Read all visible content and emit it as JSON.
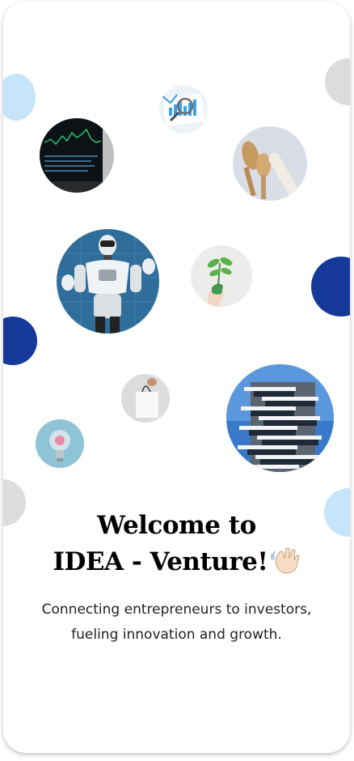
{
  "welcome": {
    "title_line1": "Welcome to",
    "title_line2": "IDEA - Venture!",
    "subtitle_line1": "Connecting entrepreneurs to investors,",
    "subtitle_line2": "fueling innovation and growth."
  },
  "colors": {
    "light_blue": "#c6e5fb",
    "dark_blue": "#17399a",
    "light_gray": "#dcdcdc",
    "background": "#ffffff"
  },
  "images": [
    "stock-chart-laptop",
    "analytics-report",
    "wooden-kitchen-utensils",
    "humanoid-robot",
    "plant-sprout-in-hand",
    "white-shopping-bag",
    "modern-building",
    "pink-lightbulb"
  ]
}
